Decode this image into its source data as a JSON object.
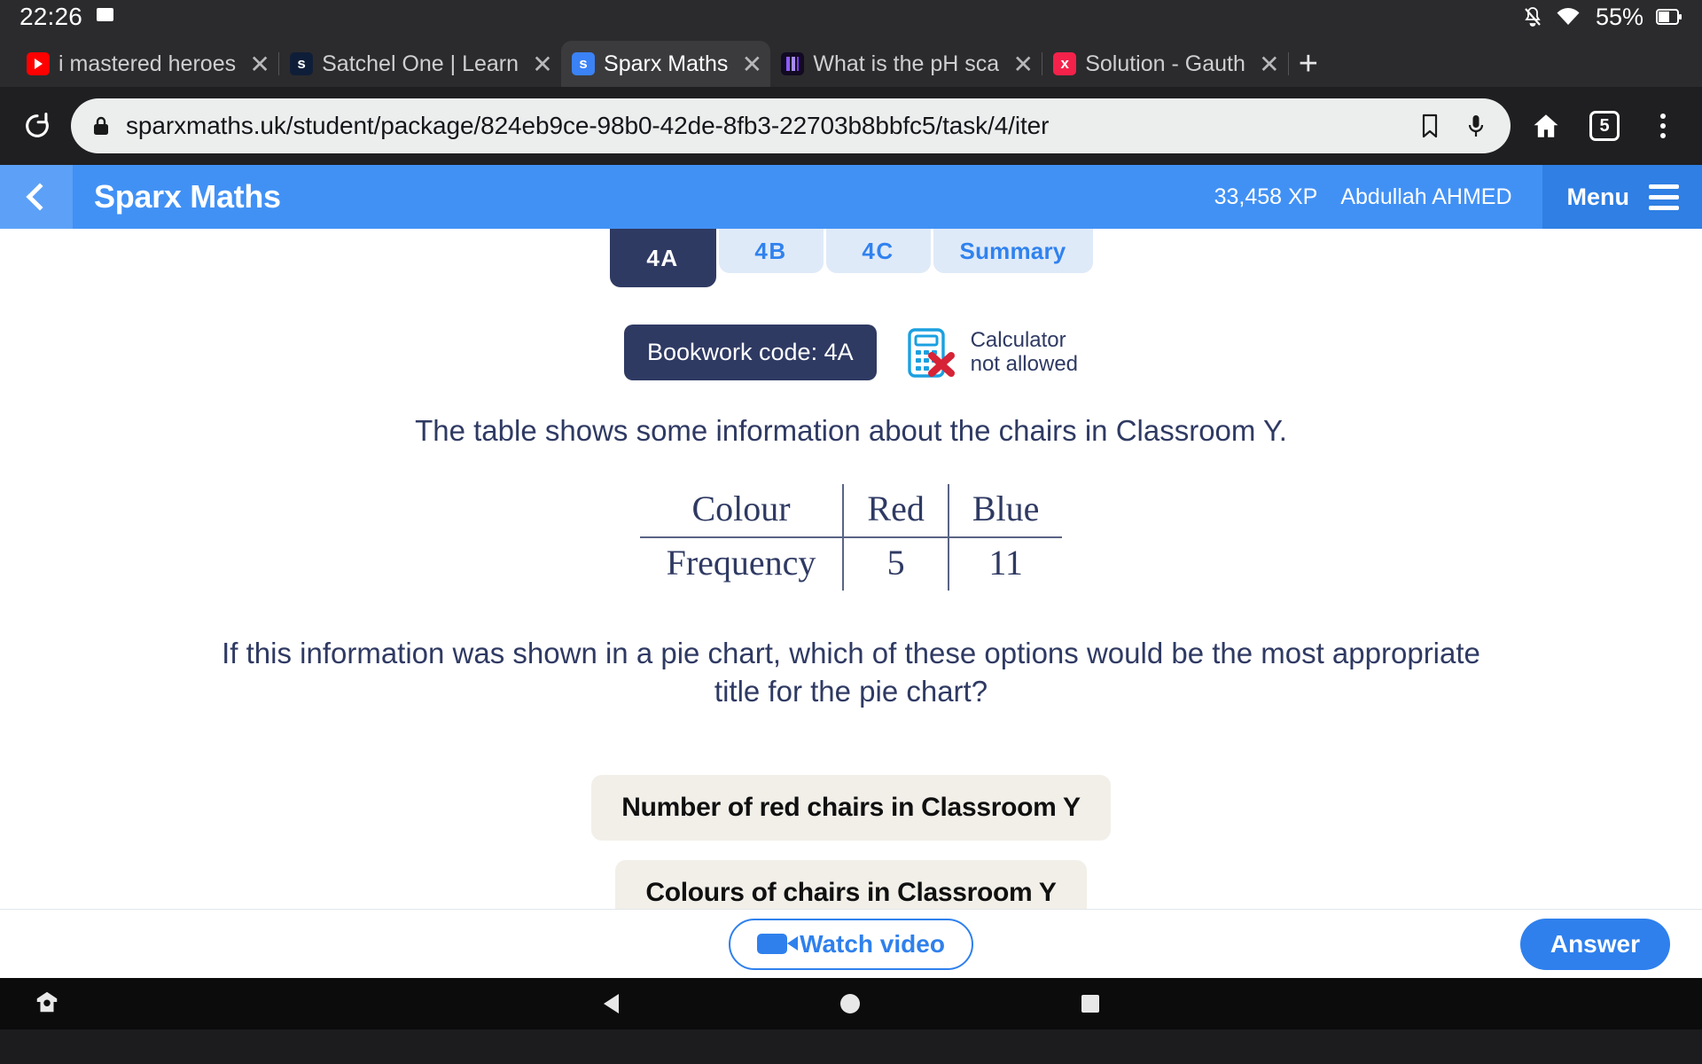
{
  "status_bar": {
    "time": "22:26",
    "battery_percent": "55%",
    "icons": [
      "screenshot-icon",
      "notifications-off-icon",
      "wifi-icon",
      "battery-icon"
    ]
  },
  "browser": {
    "tabs": [
      {
        "title": "i mastered heroes",
        "favicon": "youtube-icon",
        "active": false
      },
      {
        "title": "Satchel One | Learn",
        "favicon": "satchel-icon",
        "active": false
      },
      {
        "title": "Sparx Maths",
        "favicon": "sparx-icon",
        "active": true
      },
      {
        "title": "What is the pH sca",
        "favicon": "bbc-bitesize-icon",
        "active": false
      },
      {
        "title": "Solution - Gauth",
        "favicon": "gauth-icon",
        "active": false
      }
    ],
    "new_tab_label": "+",
    "close_label": "✕",
    "url": "sparxmaths.uk/student/package/824eb9ce-98b0-42de-8fb3-22703b8bbfc5/task/4/iter",
    "tab_count": "5",
    "toolbar_icons": [
      "reload-icon",
      "lock-icon",
      "bookmark-icon",
      "microphone-icon",
      "home-icon",
      "tab-count-icon",
      "overflow-menu-icon"
    ]
  },
  "app_header": {
    "title": "Sparx Maths",
    "xp": "33,458 XP",
    "user": "Abdullah AHMED",
    "menu_label": "Menu"
  },
  "subtabs": [
    {
      "label": "4A",
      "active": true
    },
    {
      "label": "4B",
      "active": false
    },
    {
      "label": "4C",
      "active": false
    },
    {
      "label": "Summary",
      "active": false
    }
  ],
  "meta": {
    "bookwork_code": "Bookwork code: 4A",
    "calculator_line1": "Calculator",
    "calculator_line2": "not allowed"
  },
  "question": {
    "intro": "The table shows some information about the chairs in Classroom Y.",
    "prompt": "If this information was shown in a pie chart, which of these options would be the most appropriate title for the pie chart?"
  },
  "table": {
    "row_labels": [
      "Colour",
      "Frequency"
    ],
    "columns": [
      "Red",
      "Blue"
    ],
    "frequencies": [
      "5",
      "11"
    ]
  },
  "options": [
    {
      "label": "Number of red chairs in Classroom Y"
    },
    {
      "label": "Colours of chairs in Classroom Y"
    }
  ],
  "bottom_bar": {
    "watch_video": "Watch video",
    "answer": "Answer"
  },
  "nav_bar": {
    "icons": [
      "accessibility-icon",
      "back-icon",
      "home-icon",
      "recents-icon"
    ]
  },
  "colors": {
    "header_blue": "#4191f5",
    "menu_blue": "#2f7fe4",
    "navy": "#2f3a63",
    "accent_blue": "#2f80ed",
    "option_bg": "#f2efe9"
  }
}
